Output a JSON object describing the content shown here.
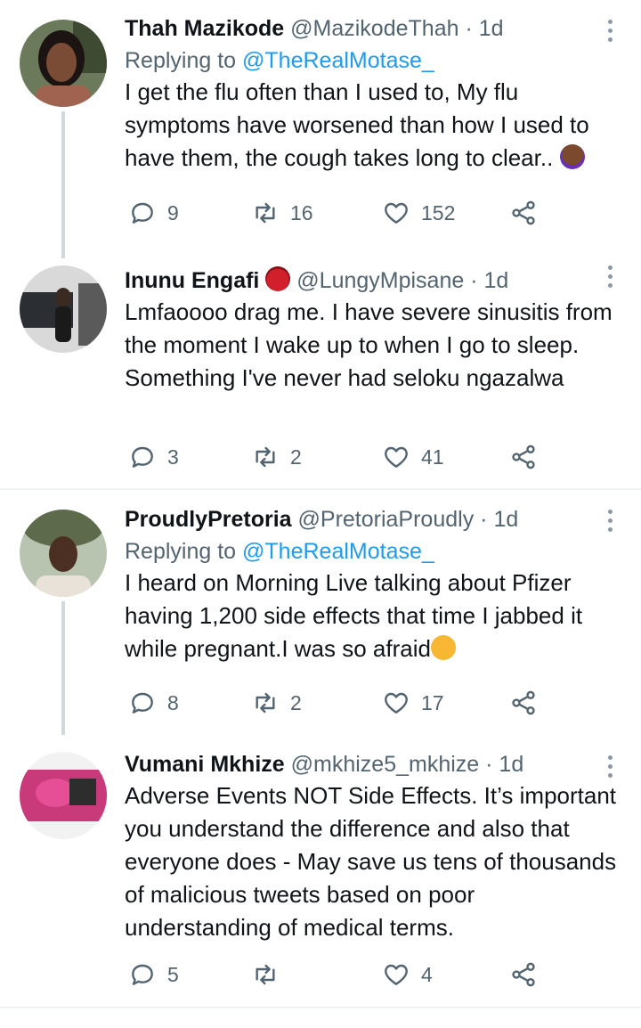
{
  "colors": {
    "accent": "#1d9bf0",
    "secondary_text": "#536471",
    "thread_line": "#cfd9de"
  },
  "tweets": [
    {
      "name": "Thah Mazikode",
      "handle": "@MazikodeThah",
      "separator": "·",
      "time": "1d",
      "replying_label": "Replying to",
      "replying_mention": "@TheRealMotase_",
      "text": "I get the flu often than I used to, My flu symptoms have worsened than how I used to have them, the cough takes long to clear..",
      "trailing_emoji": "woman-facepalming-emoji",
      "replies": "9",
      "retweets": "16",
      "likes": "152"
    },
    {
      "name": "Inunu Engafi",
      "name_emoji": "ogre-emoji",
      "handle": "@LungyMpisane",
      "separator": "·",
      "time": "1d",
      "text": "Lmfaoooo drag me. I have severe sinusitis from the moment I wake up to when I go to sleep. Something I've never had  seloku ngazalwa",
      "replies": "3",
      "retweets": "2",
      "likes": "41"
    },
    {
      "name": "ProudlyPretoria",
      "handle": "@PretoriaProudly",
      "separator": "·",
      "time": "1d",
      "replying_label": "Replying to",
      "replying_mention": "@TheRealMotase_",
      "text": "I heard on Morning Live talking about Pfizer having 1,200 side effects that time I jabbed it while pregnant.I was so afraid",
      "trailing_emoji": "weary-face-emoji",
      "replies": "8",
      "retweets": "2",
      "likes": "17"
    },
    {
      "name": "Vumani Mkhize",
      "handle": "@mkhize5_mkhize",
      "separator": "·",
      "time": "1d",
      "text": "Adverse Events NOT Side Effects. It’s important you understand the difference and also that everyone does - May save us tens of thousands of malicious tweets based on poor understanding of medical terms.",
      "replies": "5",
      "retweets": "",
      "likes": "4"
    }
  ]
}
